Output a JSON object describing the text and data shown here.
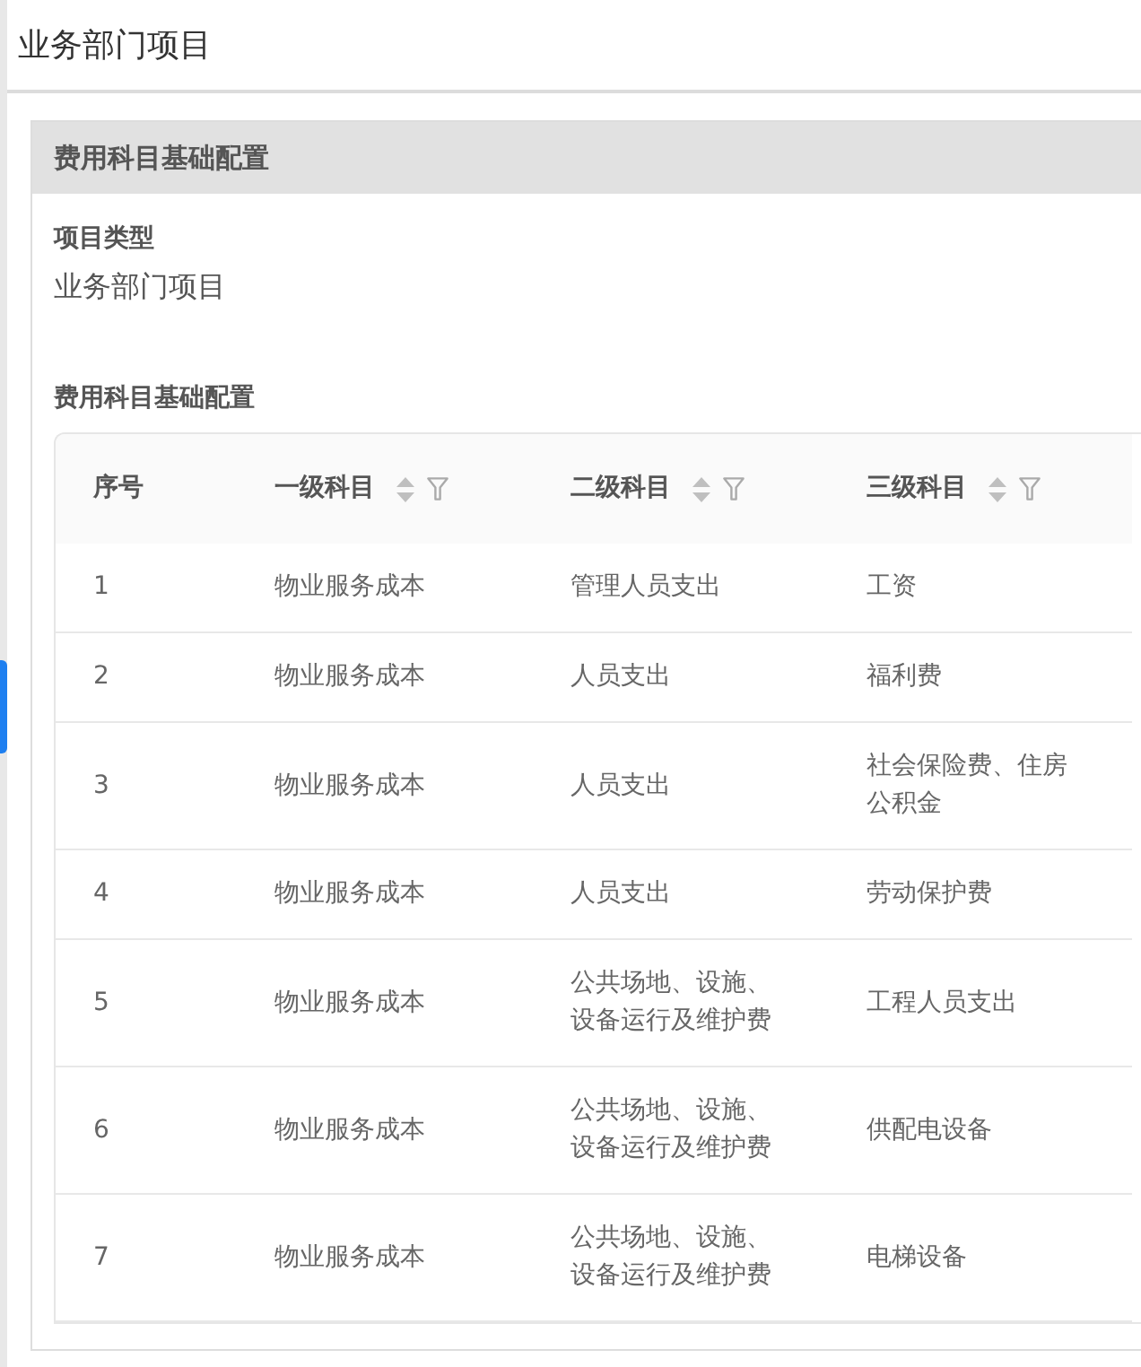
{
  "page_title": "业务部门项目",
  "panel": {
    "title": "费用科目基础配置",
    "project_type": {
      "label": "项目类型",
      "value": "业务部门项目"
    },
    "table_title": "费用科目基础配置",
    "table": {
      "columns": [
        {
          "label": "序号",
          "sortable": false,
          "filterable": false
        },
        {
          "label": "一级科目",
          "sortable": true,
          "filterable": true
        },
        {
          "label": "二级科目",
          "sortable": true,
          "filterable": true
        },
        {
          "label": "三级科目",
          "sortable": true,
          "filterable": true
        }
      ],
      "rows": [
        [
          "1",
          "物业服务成本",
          "管理人员支出",
          "工资"
        ],
        [
          "2",
          "物业服务成本",
          "人员支出",
          "福利费"
        ],
        [
          "3",
          "物业服务成本",
          "人员支出",
          "社会保险费、住房公积金"
        ],
        [
          "4",
          "物业服务成本",
          "人员支出",
          "劳动保护费"
        ],
        [
          "5",
          "物业服务成本",
          "公共场地、设施、设备运行及维护费",
          "工程人员支出"
        ],
        [
          "6",
          "物业服务成本",
          "公共场地、设施、设备运行及维护费",
          "供配电设备"
        ],
        [
          "7",
          "物业服务成本",
          "公共场地、设施、设备运行及维护费",
          "电梯设备"
        ]
      ]
    }
  }
}
